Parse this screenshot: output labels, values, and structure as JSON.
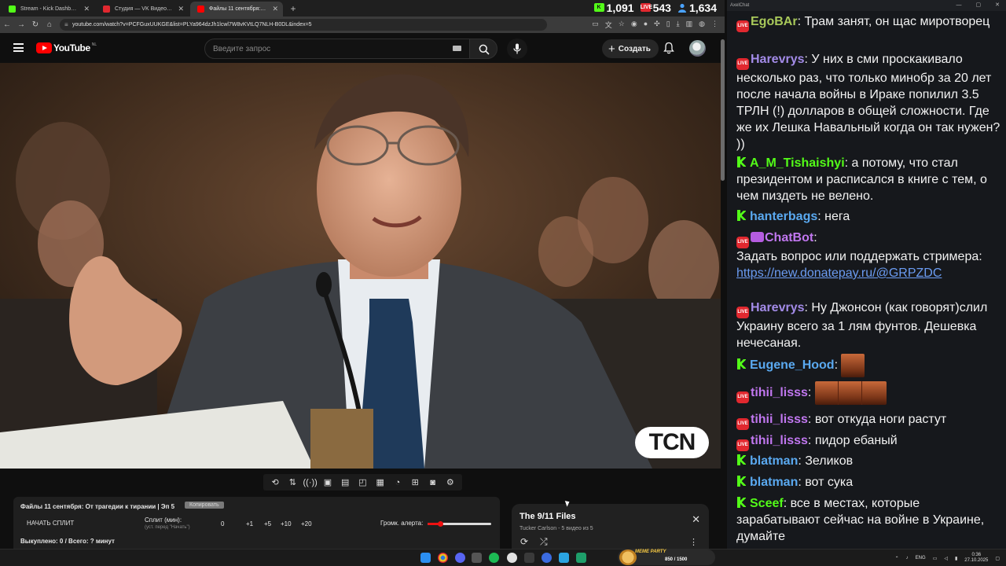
{
  "browser": {
    "tabs": [
      {
        "label": "Stream - Kick Dashboard",
        "favicon_color": "#53fc18",
        "active": false
      },
      {
        "label": "Студия — VK Видео Live",
        "favicon_color": "#e1282f",
        "active": false
      },
      {
        "label": "Файлы 11 сентября: От тр...",
        "favicon_color": "#ff0000",
        "active": true
      }
    ],
    "new_tab": "+",
    "url": "youtube.com/watch?v=PCFGuxUUKGE&list=PLYa964dzJh1lcwl7W8vKVtLQ7NLH-B0DL&index=5",
    "viewer_badges": [
      {
        "platform": "kick",
        "value": "1,091",
        "color": "#53fc18"
      },
      {
        "platform": "vk",
        "value": "543",
        "color": "#e1282f"
      },
      {
        "platform": "total",
        "value": "1,634",
        "color": "#4aa3ff"
      }
    ]
  },
  "youtube": {
    "logo_text": "YouTube",
    "country": "NL",
    "search_placeholder": "Введите запрос",
    "create_label": "Создать"
  },
  "video": {
    "watermark": "TCN"
  },
  "extension": {
    "title": "Файлы 11 сентября: От трагедии к тирании | Эп 5",
    "copy_label": "Копировать",
    "start_split": "НАЧАТЬ СПЛИТ",
    "split_label": "Сплит (мин):",
    "split_hint": "(уст. перед \"Начать\")",
    "split_value": "0",
    "steps": [
      "+1",
      "+5",
      "+10",
      "+20"
    ],
    "alert_volume_label": "Громк. алерта:",
    "alert_volume_level": 0.2,
    "bought": "Выкуплено: 0 / Всего: ? минут"
  },
  "playlist": {
    "title": "The 9/11 Files",
    "subtitle": "Tucker Carlson - 5 видео из 5"
  },
  "chat": {
    "window_title": "AxelChat",
    "messages": [
      {
        "platform": "vk",
        "user": "EgoBAr",
        "user_color": "#a8c85a",
        "text": "Трам занят, он щас миротворец"
      },
      {
        "platform": "vk",
        "user": "Harevrys",
        "user_color": "#a38be8",
        "text": "У них в сми проскакивало несколько раз, что только минобр за 20 лет после начала войны в Ираке попилил 3.5 ТРЛН (!) долларов в общей сложности. Где же их Лешка Навальный когда он так нужен? ))"
      },
      {
        "platform": "kick",
        "user": "A_M_Tishaishyi",
        "user_color": "#53fc18",
        "text": "а потому, что стал президентом и расписался в книге с тем, о чем пиздеть не велено."
      },
      {
        "platform": "kick",
        "user": "hanterbags",
        "user_color": "#5aa9f0",
        "text": "нега"
      },
      {
        "platform": "vk",
        "user": "ChatBot",
        "user_color": "#c177f0",
        "text": "Задать вопрос или поддержать стримера:",
        "link": "https://new.donatepay.ru/@GRPZDC"
      },
      {
        "platform": "vk",
        "user": "Harevrys",
        "user_color": "#a38be8",
        "text": "Ну Джонсон (как говорят)слил Украину всего за 1 лям фунтов. Дешевка нечесаная."
      },
      {
        "platform": "kick",
        "user": "Eugene_Hood",
        "user_color": "#5aa9f0",
        "text": ""
      },
      {
        "platform": "vk",
        "user": "tihii_lisss",
        "user_color": "#c177f0",
        "text": ""
      },
      {
        "platform": "vk",
        "user": "tihii_lisss",
        "user_color": "#c177f0",
        "text": "вот откуда ноги растут"
      },
      {
        "platform": "vk",
        "user": "tihii_lisss",
        "user_color": "#c177f0",
        "text": "пидор ебаный"
      },
      {
        "platform": "kick",
        "user": "blatman",
        "user_color": "#5aa9f0",
        "text": "Зеликов"
      },
      {
        "platform": "kick",
        "user": "blatman",
        "user_color": "#5aa9f0",
        "text": "вот сука"
      },
      {
        "platform": "kick",
        "user": "Sceef",
        "user_color": "#53fc18",
        "text": "все в местах, которые зарабатывают сейчас на войне в Украине, думайте"
      }
    ]
  },
  "taskbar": {
    "meme_party": "MEME PARTY",
    "meme_score": "850 / 1500",
    "lang": "ENG",
    "time": "0:36",
    "date": "27.10.2025"
  }
}
